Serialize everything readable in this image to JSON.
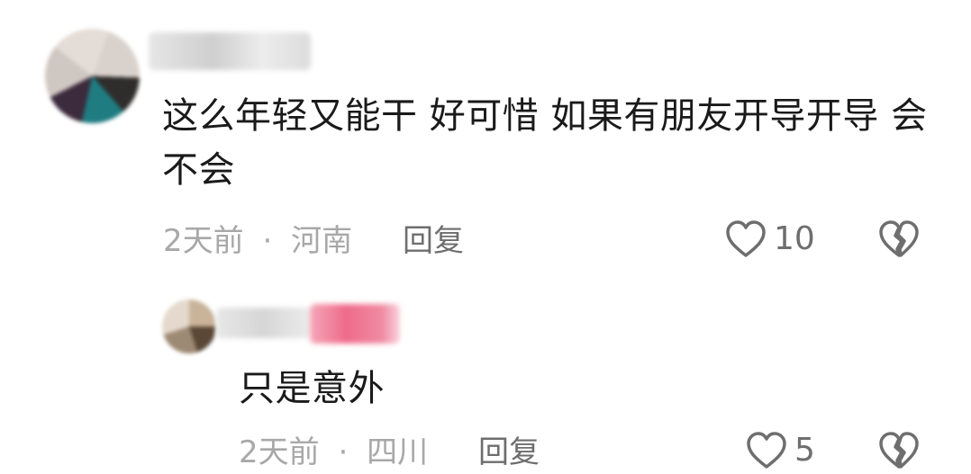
{
  "comment": {
    "text": "这么年轻又能干 好可惜 如果有朋友开导开导 会不会",
    "time": "2天前",
    "separator": "·",
    "location": "河南",
    "reply_label": "回复",
    "like_count": "10",
    "like_icon": "heart-outline-icon",
    "dislike_icon": "broken-heart-icon"
  },
  "reply": {
    "text": "只是意外",
    "time": "2天前",
    "separator": "·",
    "location": "四川",
    "reply_label": "回复",
    "like_count": "5",
    "like_icon": "heart-outline-icon",
    "dislike_icon": "broken-heart-icon"
  },
  "colors": {
    "text": "#1a1a1a",
    "meta": "#a8a8a8",
    "action": "#6e6e6e"
  }
}
